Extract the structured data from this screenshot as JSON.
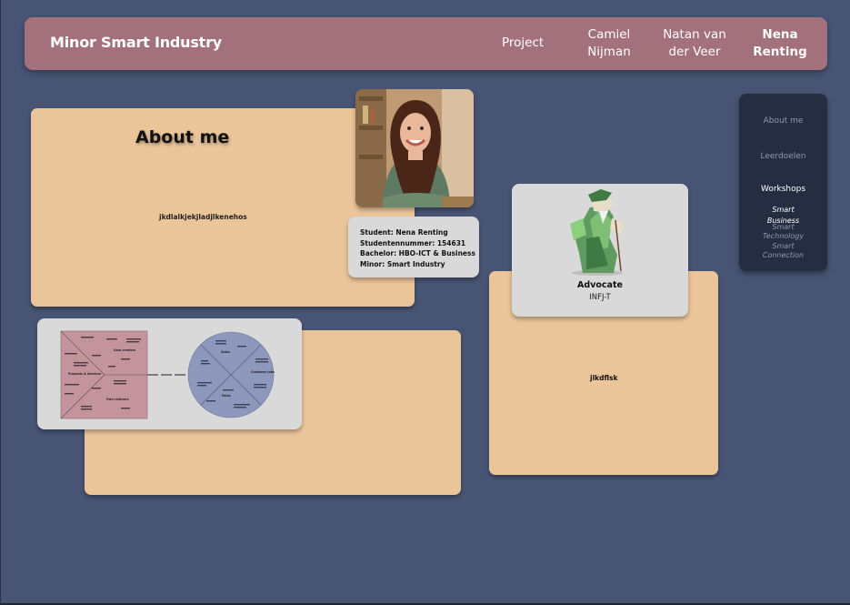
{
  "header": {
    "brand": "Minor Smart Industry",
    "nav": [
      {
        "label": "Project"
      },
      {
        "label": "Camiel Nijman"
      },
      {
        "label": "Natan van der Veer"
      },
      {
        "label": "Nena Renting",
        "active": true
      }
    ]
  },
  "about": {
    "title": "About me",
    "text": "jkdlalkjekjladjlkenehos"
  },
  "student_info": {
    "student": "Student: Nena Renting",
    "number": "Studentennummer: 154631",
    "bachelor": "Bachelor: HBO-ICT & Business",
    "minor": "Minor: Smart Industry"
  },
  "right_card": {
    "text": "jlkdflsk"
  },
  "persona": {
    "name": "Advocate",
    "type": "INFJ-T"
  },
  "sidebar": {
    "items": [
      "About me",
      "Leerdoelen",
      "Workshops"
    ],
    "sub_items": [
      "Smart Business",
      "Smart Technology",
      "Smart Connection"
    ]
  },
  "canvas": {
    "left_sections": [
      "Gain creators",
      "Products & Services",
      "Pain relievers"
    ],
    "right_sections": [
      "Gains",
      "Customer Jobs",
      "Pains"
    ]
  },
  "colors": {
    "background": "#475473",
    "header": "#a2717b",
    "card": "#ebc59a",
    "panel": "#d9d9d9",
    "sidebar": "#252d40"
  }
}
